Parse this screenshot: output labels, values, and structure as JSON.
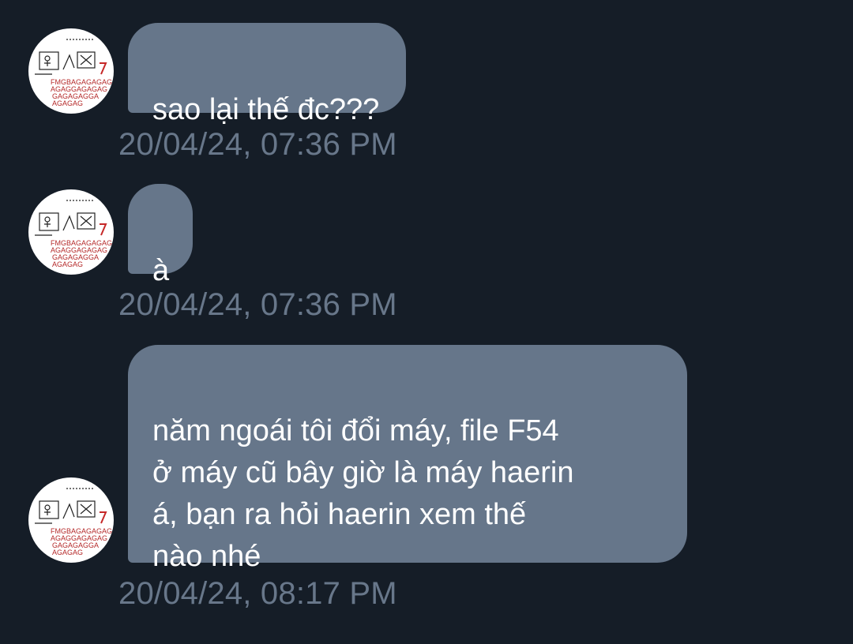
{
  "messages": [
    {
      "text": "sao lại thế đc???",
      "time": "20/04/24, 07:36 PM"
    },
    {
      "text": "à",
      "time": "20/04/24, 07:36 PM"
    },
    {
      "text": "năm ngoái tôi đổi máy, file F54\nở máy cũ bây giờ là máy haerin\ná, bạn ra hỏi haerin xem thế\nnào nhé",
      "time": "20/04/24, 08:17 PM"
    }
  ],
  "avatar": {
    "icon": "sketch-avatar-icon",
    "caption_lines": [
      "FMGBAGAGAGAG",
      "AGAGGAGAGAG",
      "GAGAGAGGA",
      "AGAGAG"
    ]
  },
  "colors": {
    "background": "#151d27",
    "bubble": "#66768a",
    "message_text": "#ffffff",
    "timestamp": "#68778a",
    "avatar_caption": "#b52a2a"
  }
}
